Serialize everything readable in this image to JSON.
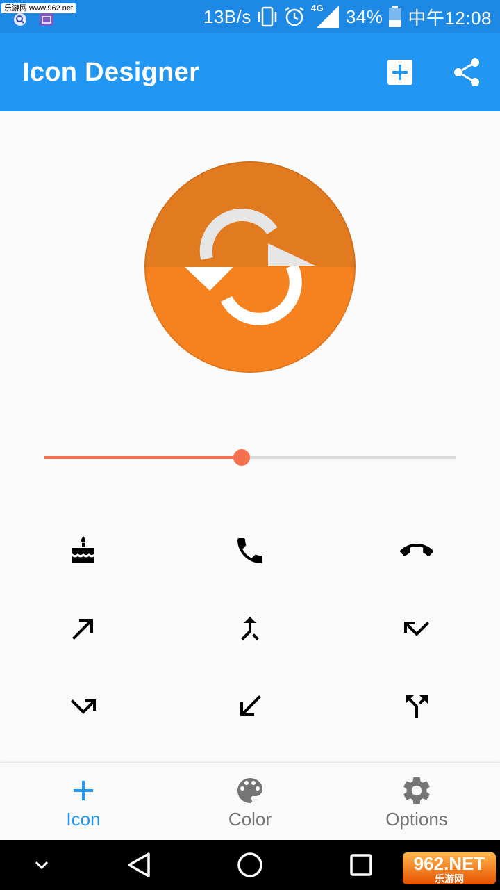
{
  "status_bar": {
    "watermark": "乐游网 www.962.net",
    "net_speed": "13B/s",
    "network_type": "4G",
    "battery": "34%",
    "time": "中午12:08",
    "icons": [
      "search-icon",
      "gallery-icon",
      "vibrate-icon",
      "alarm-icon",
      "signal-icon",
      "battery-icon"
    ]
  },
  "app_bar": {
    "title": "Icon Designer",
    "actions": [
      "add-box-icon",
      "share-icon"
    ]
  },
  "preview": {
    "icon": "sync-icon",
    "circle_color_top": "#e27a1f",
    "circle_color_bottom": "#f5821f",
    "glyph_color": "#ffffff"
  },
  "slider": {
    "value": 0.48,
    "color": "#f4704e",
    "track_color": "#d8d8d8"
  },
  "icon_grid": {
    "icons": [
      "cake-icon",
      "phone-icon",
      "call-end-icon",
      "call-made-icon",
      "call-merge-icon",
      "call-missed-icon",
      "call-missed-outgoing-icon",
      "call-received-icon",
      "call-split-icon"
    ]
  },
  "bottom_nav": {
    "items": [
      {
        "label": "Icon",
        "icon": "add-icon",
        "active": true
      },
      {
        "label": "Color",
        "icon": "palette-icon",
        "active": false
      },
      {
        "label": "Options",
        "icon": "settings-icon",
        "active": false
      }
    ],
    "active_color": "#2196f3",
    "inactive_color": "#757575"
  },
  "system_nav": {
    "buttons": [
      "chevron-down-icon",
      "back-icon",
      "home-icon",
      "recents-icon"
    ]
  },
  "watermark_logo": {
    "main": "962.NET",
    "sub": "乐游网"
  }
}
